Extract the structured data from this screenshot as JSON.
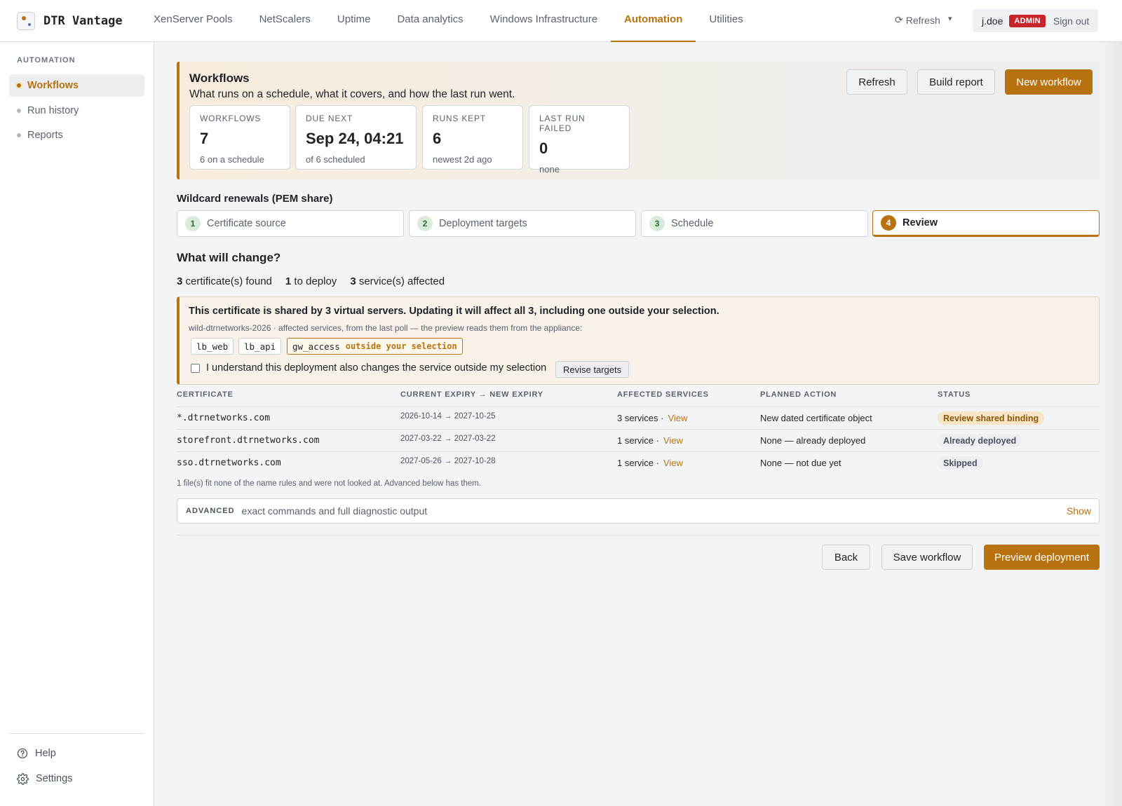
{
  "app": {
    "name": "DTR Vantage",
    "nav": [
      "XenServer Pools",
      "NetScalers",
      "Uptime",
      "Data analytics",
      "Windows Infrastructure",
      "Automation",
      "Utilities"
    ],
    "active_nav": "Automation",
    "refresh_label": "Refresh",
    "refresh_glyph": "⟳",
    "caret_glyph": "▾",
    "user": "j.doe",
    "role_badge": "ADMIN",
    "sign_out": "Sign out"
  },
  "sidebar": {
    "heading": "AUTOMATION",
    "items": [
      {
        "label": "Workflows",
        "active": true
      },
      {
        "label": "Run history",
        "active": false
      },
      {
        "label": "Reports",
        "active": false
      }
    ],
    "footer": [
      {
        "label": "Help",
        "icon": "help-circle-icon"
      },
      {
        "label": "Settings",
        "icon": "gear-icon"
      }
    ]
  },
  "hero": {
    "title": "Workflows",
    "subtitle": "What runs on a schedule, what it covers, and how the last run went.",
    "buttons": {
      "refresh": "Refresh",
      "build_report": "Build report",
      "new_workflow": "New workflow"
    },
    "stats": [
      {
        "label": "WORKFLOWS",
        "value": "7",
        "note": "6 on a schedule"
      },
      {
        "label": "DUE NEXT",
        "value": "Sep 24, 04:21",
        "note": "of 6 scheduled"
      },
      {
        "label": "RUNS KEPT",
        "value": "6",
        "note": "newest 2d ago"
      },
      {
        "label": "LAST RUN FAILED",
        "value": "0",
        "note": "none"
      }
    ]
  },
  "wizard": {
    "title": "Wildcard renewals (PEM share)",
    "steps": [
      {
        "num": "1",
        "label": "Certificate source"
      },
      {
        "num": "2",
        "label": "Deployment targets"
      },
      {
        "num": "3",
        "label": "Schedule"
      },
      {
        "num": "4",
        "label": "Review"
      }
    ],
    "active_step": 4
  },
  "review": {
    "heading": "What will change?",
    "summary": [
      {
        "count": "3",
        "text": "certificate(s) found"
      },
      {
        "count": "1",
        "text": "to deploy"
      },
      {
        "count": "3",
        "text": "service(s) affected"
      }
    ],
    "warning": {
      "title": "This certificate is shared by 3 virtual servers. Updating it will affect all 3, including one outside your selection.",
      "subtitle": "wild-dtrnetworks-2026 · affected services, from the last poll — the preview reads them from the appliance:",
      "chips": [
        "lb_web",
        "lb_api",
        "gw_access"
      ],
      "outside_tag": "outside your selection",
      "acknowledge": "I understand this deployment also changes the service outside my selection",
      "acknowledged": false,
      "revise_button": "Revise targets"
    },
    "table": {
      "columns": [
        "CERTIFICATE",
        "CURRENT EXPIRY → NEW EXPIRY",
        "AFFECTED SERVICES",
        "PLANNED ACTION",
        "STATUS"
      ],
      "rows": [
        {
          "certificate": "*.dtrnetworks.com",
          "current": "2026-10-14",
          "arrow": "→",
          "new": "2027-10-25",
          "services": "3 services ·",
          "view": "View",
          "action": "New dated certificate object",
          "status": "Review shared binding",
          "status_kind": "warning"
        },
        {
          "certificate": "storefront.dtrnetworks.com",
          "current": "2027-03-22",
          "arrow": "→",
          "new": "2027-03-22",
          "services": "1 service ·",
          "view": "View",
          "action": "None — already deployed",
          "status": "Already deployed",
          "status_kind": "neutral"
        },
        {
          "certificate": "sso.dtrnetworks.com",
          "current": "2027-05-26",
          "arrow": "→",
          "new": "2027-10-28",
          "services": "1 service ·",
          "view": "View",
          "action": "None — not due yet",
          "status": "Skipped",
          "status_kind": "neutral"
        }
      ]
    },
    "footnote": "1 file(s) fit none of the name rules and were not looked at. Advanced below has them.",
    "advanced": {
      "label": "ADVANCED",
      "description": "exact commands and full diagnostic output",
      "toggle": "Show"
    },
    "actions": {
      "back": "Back",
      "save": "Save workflow",
      "preview": "Preview deployment"
    }
  },
  "colors": {
    "accent": "#b8720f",
    "danger": "#c8242b",
    "success_bg": "#d9ecd9"
  }
}
